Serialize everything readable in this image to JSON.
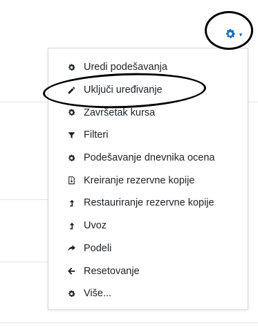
{
  "settings": {
    "menu_toggle_caret": "▾"
  },
  "menu": {
    "items": [
      {
        "label": "Uredi podešavanja",
        "icon": "gear-icon"
      },
      {
        "label": "Uključi uređivanje",
        "icon": "pencil-icon"
      },
      {
        "label": "Završetak kursa",
        "icon": "gear-icon"
      },
      {
        "label": "Filteri",
        "icon": "filter-icon"
      },
      {
        "label": "Podešavanje dnevnika ocena",
        "icon": "gear-icon"
      },
      {
        "label": "Kreiranje rezervne kopije",
        "icon": "file-archive-icon"
      },
      {
        "label": "Restauriranje rezervne kopije",
        "icon": "level-up-icon"
      },
      {
        "label": "Uvoz",
        "icon": "level-up-icon"
      },
      {
        "label": "Podeli",
        "icon": "share-icon"
      },
      {
        "label": "Resetovanje",
        "icon": "arrow-left-icon"
      },
      {
        "label": "Više...",
        "icon": "gear-icon"
      }
    ]
  },
  "colors": {
    "accent": "#0f6cbf",
    "text": "#1d2125",
    "annotation": "#000000"
  }
}
